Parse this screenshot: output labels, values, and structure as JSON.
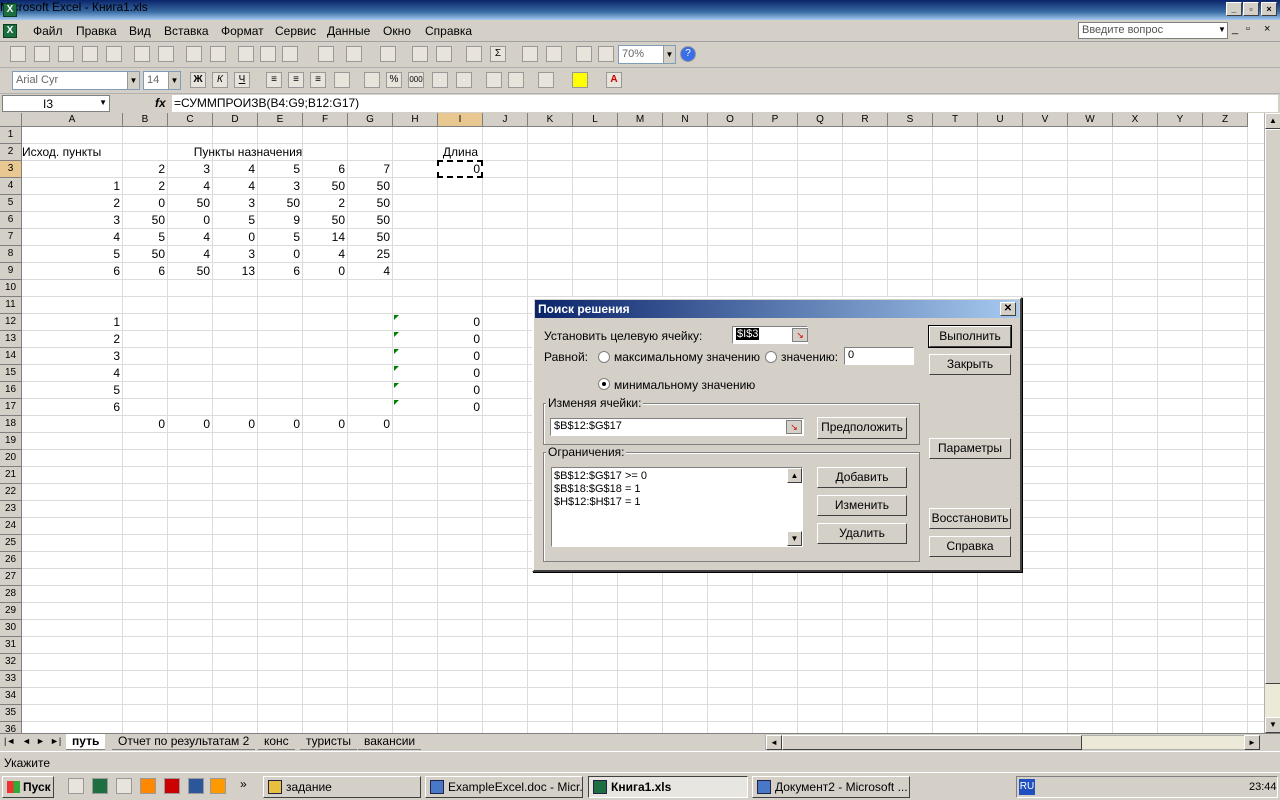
{
  "window": {
    "title": "Microsoft Excel - Книга1.xls"
  },
  "menu": {
    "items": [
      "Файл",
      "Правка",
      "Вид",
      "Вставка",
      "Формат",
      "Сервис",
      "Данные",
      "Окно",
      "Справка"
    ],
    "help_placeholder": "Введите вопрос"
  },
  "toolbar": {
    "zoom": "70%",
    "font": "Arial Cyr",
    "size": "14"
  },
  "formula_bar": {
    "name_box": "I3",
    "fx": "fx",
    "formula": "=СУММПРОИЗВ(B4:G9;B12:G17)"
  },
  "grid": {
    "columns": [
      "A",
      "B",
      "C",
      "D",
      "E",
      "F",
      "G",
      "H",
      "I",
      "J",
      "K",
      "L",
      "M",
      "N",
      "O",
      "P",
      "Q",
      "R",
      "S",
      "T",
      "U",
      "V",
      "W",
      "X",
      "Y",
      "Z"
    ],
    "rows": [
      "1",
      "2",
      "3",
      "4",
      "5",
      "6",
      "7",
      "8",
      "9",
      "10",
      "11",
      "12",
      "13",
      "14",
      "15",
      "16",
      "17",
      "18",
      "19",
      "20",
      "21",
      "22",
      "23",
      "24",
      "25",
      "26",
      "27",
      "28",
      "29",
      "30",
      "31",
      "32",
      "33",
      "34",
      "35",
      "36"
    ],
    "selected_cell": "I3",
    "labels": {
      "A2": "Исход. пункты",
      "C2": "Пункты назначения",
      "I2": "Длина"
    },
    "header_row": [
      "2",
      "3",
      "4",
      "5",
      "6",
      "7"
    ],
    "matrix_rows": [
      {
        "src": "1",
        "values": [
          "2",
          "4",
          "4",
          "3",
          "50",
          "50"
        ]
      },
      {
        "src": "2",
        "values": [
          "0",
          "50",
          "3",
          "50",
          "2",
          "50"
        ]
      },
      {
        "src": "3",
        "values": [
          "50",
          "0",
          "5",
          "9",
          "50",
          "50"
        ]
      },
      {
        "src": "4",
        "values": [
          "5",
          "4",
          "0",
          "5",
          "14",
          "50"
        ]
      },
      {
        "src": "5",
        "values": [
          "50",
          "4",
          "3",
          "0",
          "4",
          "25"
        ]
      },
      {
        "src": "6",
        "values": [
          "6",
          "50",
          "13",
          "6",
          "0",
          "4"
        ]
      }
    ],
    "I3": "0",
    "decision_rows": [
      "1",
      "2",
      "3",
      "4",
      "5",
      "6"
    ],
    "h_values": [
      "0",
      "0",
      "0",
      "0",
      "0",
      "0"
    ],
    "row18": [
      "0",
      "0",
      "0",
      "0",
      "0",
      "0"
    ]
  },
  "sheet_tabs": [
    {
      "label": "путь",
      "active": true
    },
    {
      "label": "Отчет по результатам 2",
      "active": false
    },
    {
      "label": "конс",
      "active": false
    },
    {
      "label": "туристы",
      "active": false
    },
    {
      "label": "вакансии",
      "active": false
    }
  ],
  "status": "Укажите",
  "taskbar": {
    "start": "Пуск",
    "tasks": [
      {
        "label": "задание",
        "active": false
      },
      {
        "label": "ExampleExcel.doc - Micr...",
        "active": false
      },
      {
        "label": "Книга1.xls",
        "active": true
      },
      {
        "label": "Документ2 - Microsoft ...",
        "active": false
      }
    ],
    "lang": "RU",
    "clock": "23:44"
  },
  "solver": {
    "title": "Поиск решения",
    "target_label": "Установить целевую ячейку:",
    "target_value": "$I$3",
    "equal_label": "Равной:",
    "opt_max": "максимальному значению",
    "opt_value": "значению:",
    "value_input": "0",
    "opt_min": "минимальному значению",
    "changing_label": "Изменяя ячейки:",
    "changing_value": "$B$12:$G$17",
    "guess_btn": "Предположить",
    "constraints_label": "Ограничения:",
    "constraints": [
      "$B$12:$G$17 >= 0",
      "$B$18:$G$18 = 1",
      "$H$12:$H$17 = 1"
    ],
    "add_btn": "Добавить",
    "change_btn": "Изменить",
    "delete_btn": "Удалить",
    "run_btn": "Выполнить",
    "close_btn": "Закрыть",
    "params_btn": "Параметры",
    "reset_btn": "Восстановить",
    "help_btn": "Справка"
  }
}
